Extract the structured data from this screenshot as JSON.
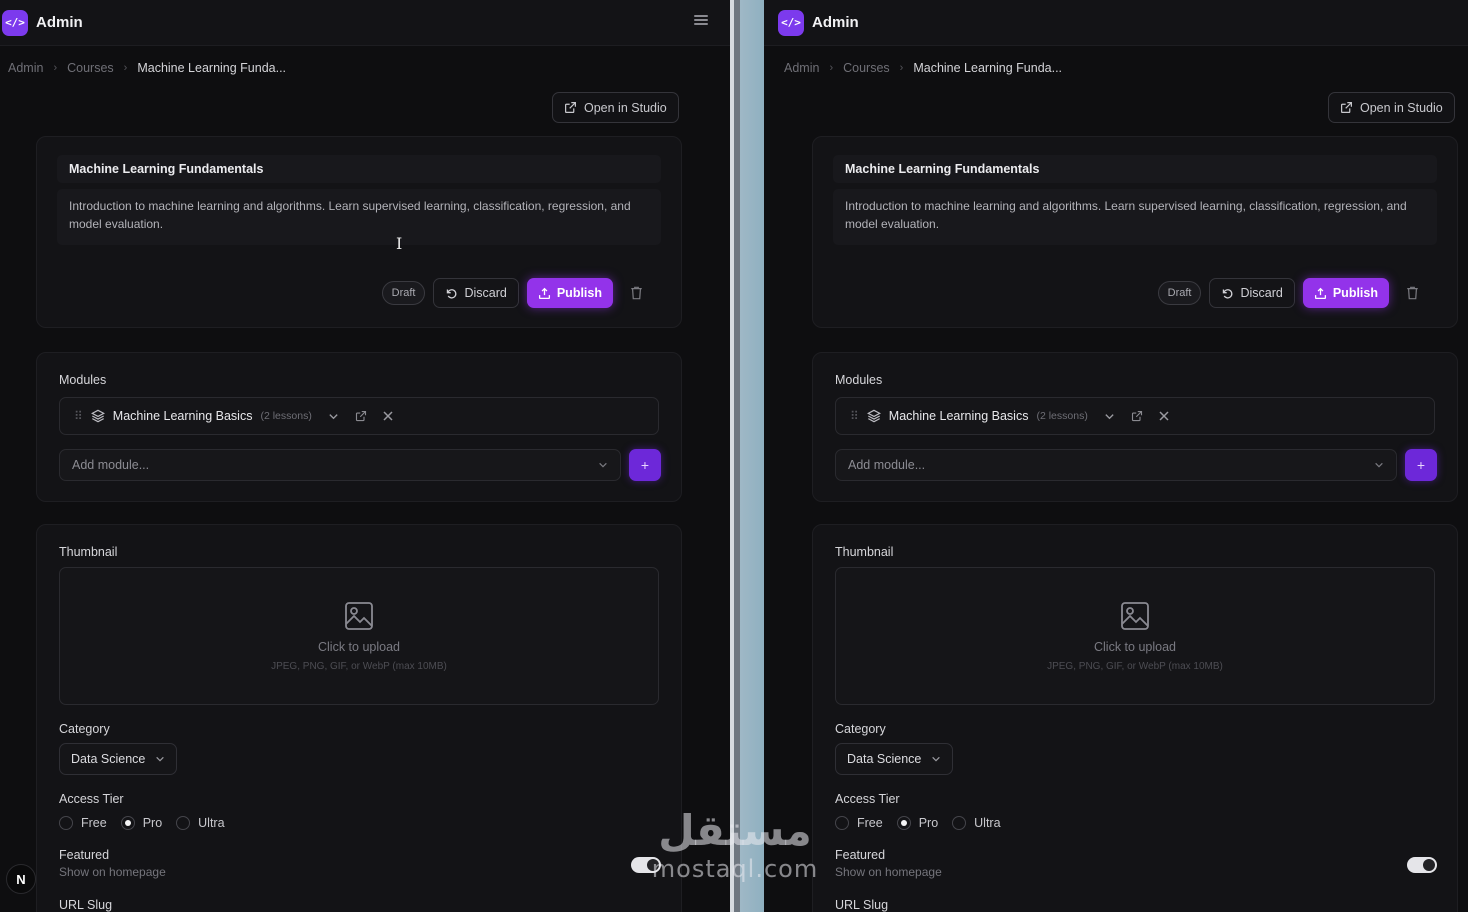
{
  "app": {
    "title": "Admin",
    "logo_glyph": "</>"
  },
  "breadcrumb": {
    "items": [
      "Admin",
      "Courses"
    ],
    "current": "Machine Learning Funda..."
  },
  "toolbar": {
    "open_in_studio": "Open in Studio"
  },
  "course": {
    "title": "Machine Learning Fundamentals",
    "description": "Introduction to machine learning and algorithms. Learn supervised learning, classification, regression, and model evaluation."
  },
  "actions": {
    "status": "Draft",
    "discard": "Discard",
    "publish": "Publish"
  },
  "modules": {
    "label": "Modules",
    "items": [
      {
        "name": "Machine Learning Basics",
        "lessons": "(2 lessons)"
      }
    ],
    "add_placeholder": "Add module...",
    "add_button": "+"
  },
  "thumbnail": {
    "label": "Thumbnail",
    "upload_text": "Click to upload",
    "upload_hint": "JPEG, PNG, GIF, or WebP (max 10MB)"
  },
  "category": {
    "label": "Category",
    "value": "Data Science"
  },
  "access_tier": {
    "label": "Access Tier",
    "options": [
      "Free",
      "Pro",
      "Ultra"
    ],
    "selected": "Pro"
  },
  "featured": {
    "label": "Featured",
    "subtitle": "Show on homepage",
    "enabled": true
  },
  "url_slug": {
    "label": "URL Slug"
  },
  "overlay": {
    "badge": "N",
    "watermark_arabic": "مستقل",
    "watermark_latin": "mostaql.com"
  },
  "colors": {
    "accent": "#9333ea",
    "background": "#0e0e10",
    "card": "#131316"
  }
}
